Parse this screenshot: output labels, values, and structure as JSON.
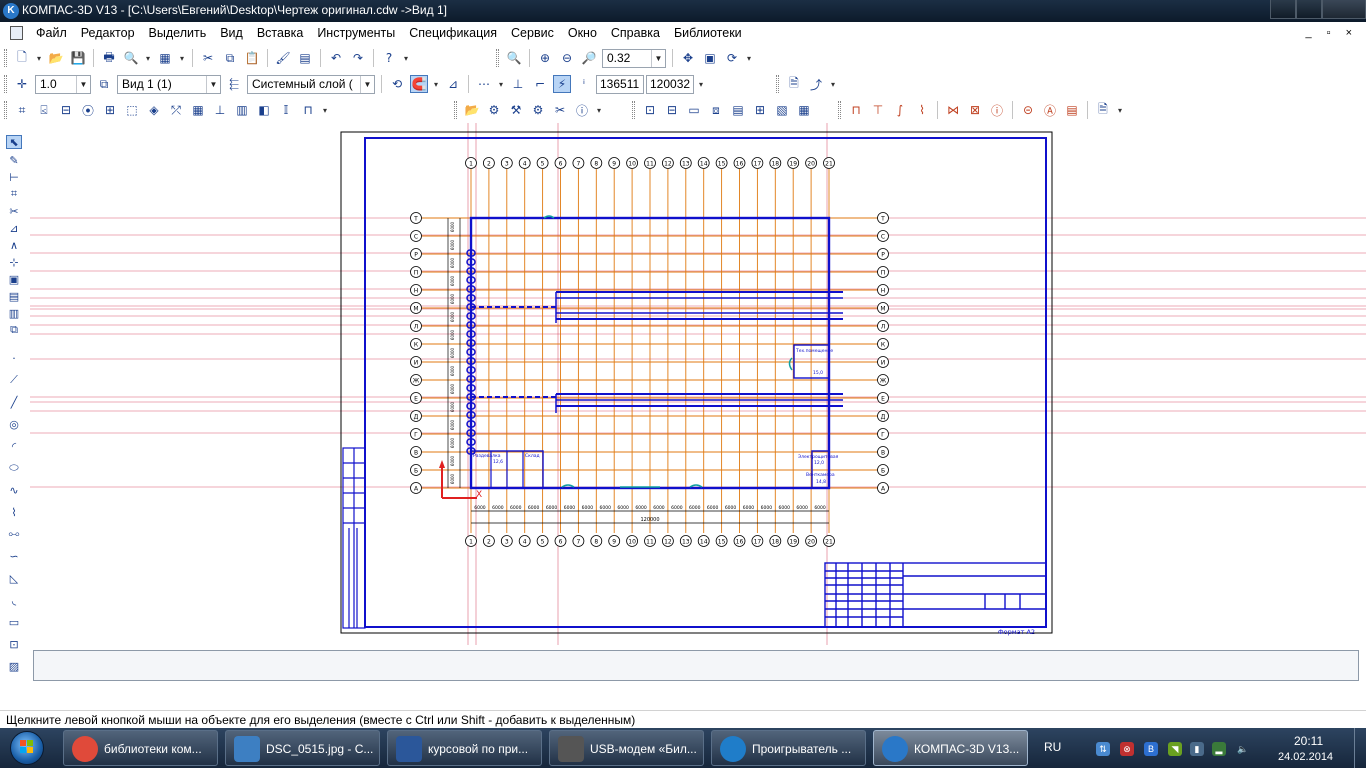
{
  "window": {
    "title": "КОМПАС-3D V13 - [C:\\Users\\Евгений\\Desktop\\Чертеж оригинал.cdw ->Вид 1]",
    "icon": "kompas-logo-icon"
  },
  "menu": {
    "items": [
      "Файл",
      "Редактор",
      "Выделить",
      "Вид",
      "Вставка",
      "Инструменты",
      "Спецификация",
      "Сервис",
      "Окно",
      "Справка",
      "Библиотеки"
    ],
    "doc_controls": "_ ▫ ×"
  },
  "toolbar1": {
    "zoom_value": "0.32"
  },
  "toolbar2": {
    "step": "1.0",
    "view": "Вид 1 (1)",
    "layer": "Системный слой (",
    "cursor_x": "136511",
    "cursor_y": "120032"
  },
  "drawing": {
    "axis_labels_top": [
      "1",
      "2",
      "3",
      "4",
      "5",
      "6",
      "7",
      "8",
      "9",
      "10",
      "11",
      "12",
      "13",
      "14",
      "15",
      "16",
      "17",
      "18",
      "19",
      "20",
      "21"
    ],
    "axis_labels_side": [
      "Т",
      "С",
      "Р",
      "П",
      "Н",
      "М",
      "Л",
      "К",
      "И",
      "Ж",
      "Е",
      "Д",
      "Г",
      "В",
      "Б",
      "А"
    ],
    "bay_dims": [
      "6000",
      "6000",
      "6000",
      "6000",
      "6000",
      "6000",
      "6000",
      "6000",
      "6000",
      "6000",
      "6000",
      "6000",
      "6000",
      "6000",
      "6000",
      "6000",
      "6000",
      "6000",
      "6000",
      "6000"
    ],
    "total_dim": "120000",
    "stamp_sheet": "Формат  А2"
  },
  "status": {
    "hint": "Щелкните левой кнопкой мыши на объекте для его выделения (вместе с Ctrl или Shift - добавить к выделенным)"
  },
  "taskbar": {
    "buttons": [
      {
        "label": "библиотеки ком...",
        "icon": "chrome-icon",
        "color": "#e04a3a"
      },
      {
        "label": "DSC_0515.jpg - С...",
        "icon": "image-viewer-icon",
        "color": "#3d7fc2"
      },
      {
        "label": "курсовой по при...",
        "icon": "word-icon",
        "color": "#2b579a"
      },
      {
        "label": "USB-модем «Бил...",
        "icon": "modem-icon",
        "color": "#555555"
      },
      {
        "label": "Проигрыватель ...",
        "icon": "media-player-icon",
        "color": "#1f7dc9"
      },
      {
        "label": "КОМПАС-3D V13...",
        "icon": "kompas-logo-icon",
        "color": "#2a78c8"
      }
    ],
    "lang": "RU",
    "time": "20:11",
    "date": "24.02.2014"
  },
  "colors": {
    "drawing_blue": "#1010cc",
    "axis_orange": "#e07a10",
    "axis_red": "#cc2040",
    "green": "#10aa10"
  }
}
